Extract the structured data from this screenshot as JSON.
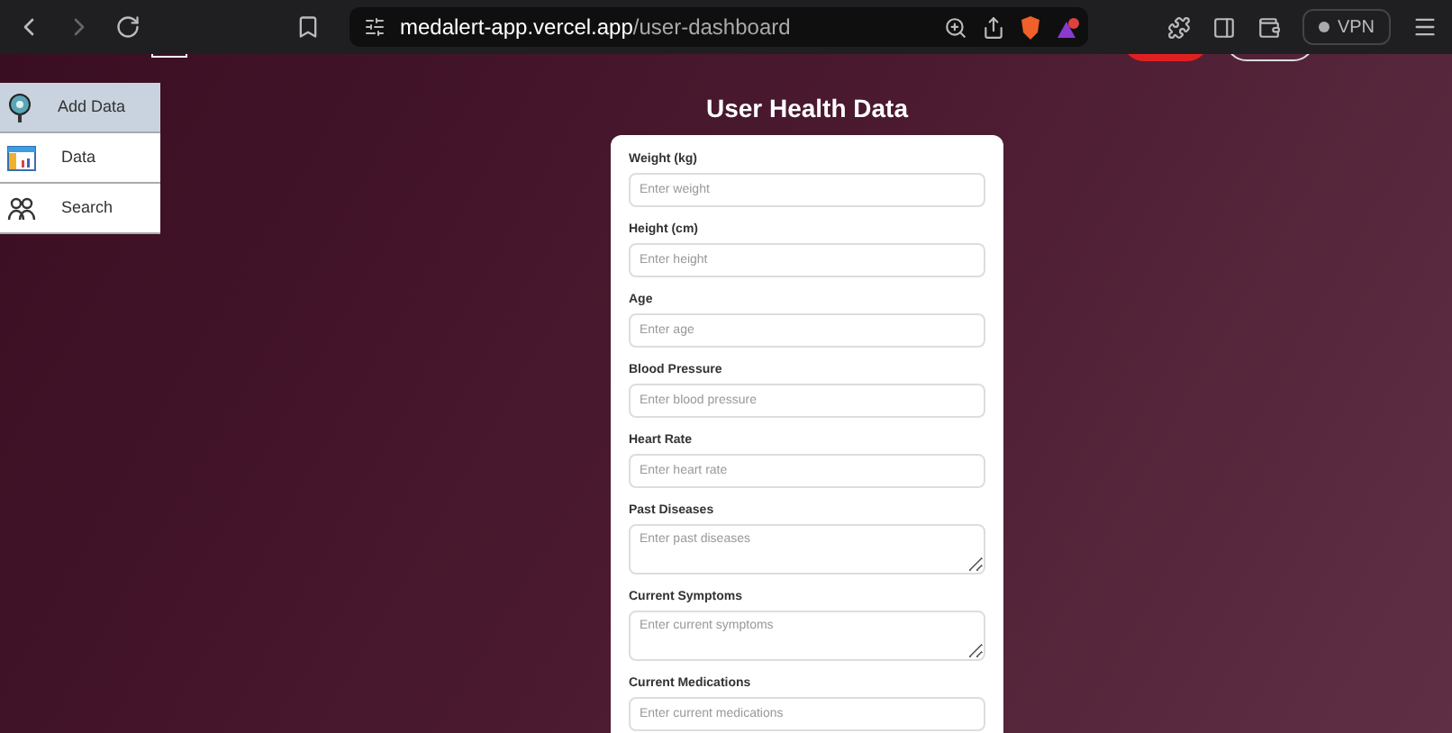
{
  "browser": {
    "url_host": "medalert-app.vercel.app",
    "url_path": "/user-dashboard",
    "vpn_label": "VPN"
  },
  "sidebar": {
    "items": [
      {
        "label": "Add Data",
        "selected": true,
        "kind": "pin"
      },
      {
        "label": "Data",
        "selected": false,
        "kind": "chart"
      },
      {
        "label": "Search",
        "selected": false,
        "kind": "people"
      }
    ]
  },
  "form": {
    "title": "User Health Data",
    "fields": [
      {
        "label": "Weight (kg)",
        "placeholder": "Enter weight",
        "kind": "input"
      },
      {
        "label": "Height (cm)",
        "placeholder": "Enter height",
        "kind": "input"
      },
      {
        "label": "Age",
        "placeholder": "Enter age",
        "kind": "input"
      },
      {
        "label": "Blood Pressure",
        "placeholder": "Enter blood pressure",
        "kind": "input"
      },
      {
        "label": "Heart Rate",
        "placeholder": "Enter heart rate",
        "kind": "input"
      },
      {
        "label": "Past Diseases",
        "placeholder": "Enter past diseases",
        "kind": "textarea"
      },
      {
        "label": "Current Symptoms",
        "placeholder": "Enter current symptoms",
        "kind": "textarea"
      },
      {
        "label": "Current Medications",
        "placeholder": "Enter current medications",
        "kind": "input"
      }
    ]
  }
}
